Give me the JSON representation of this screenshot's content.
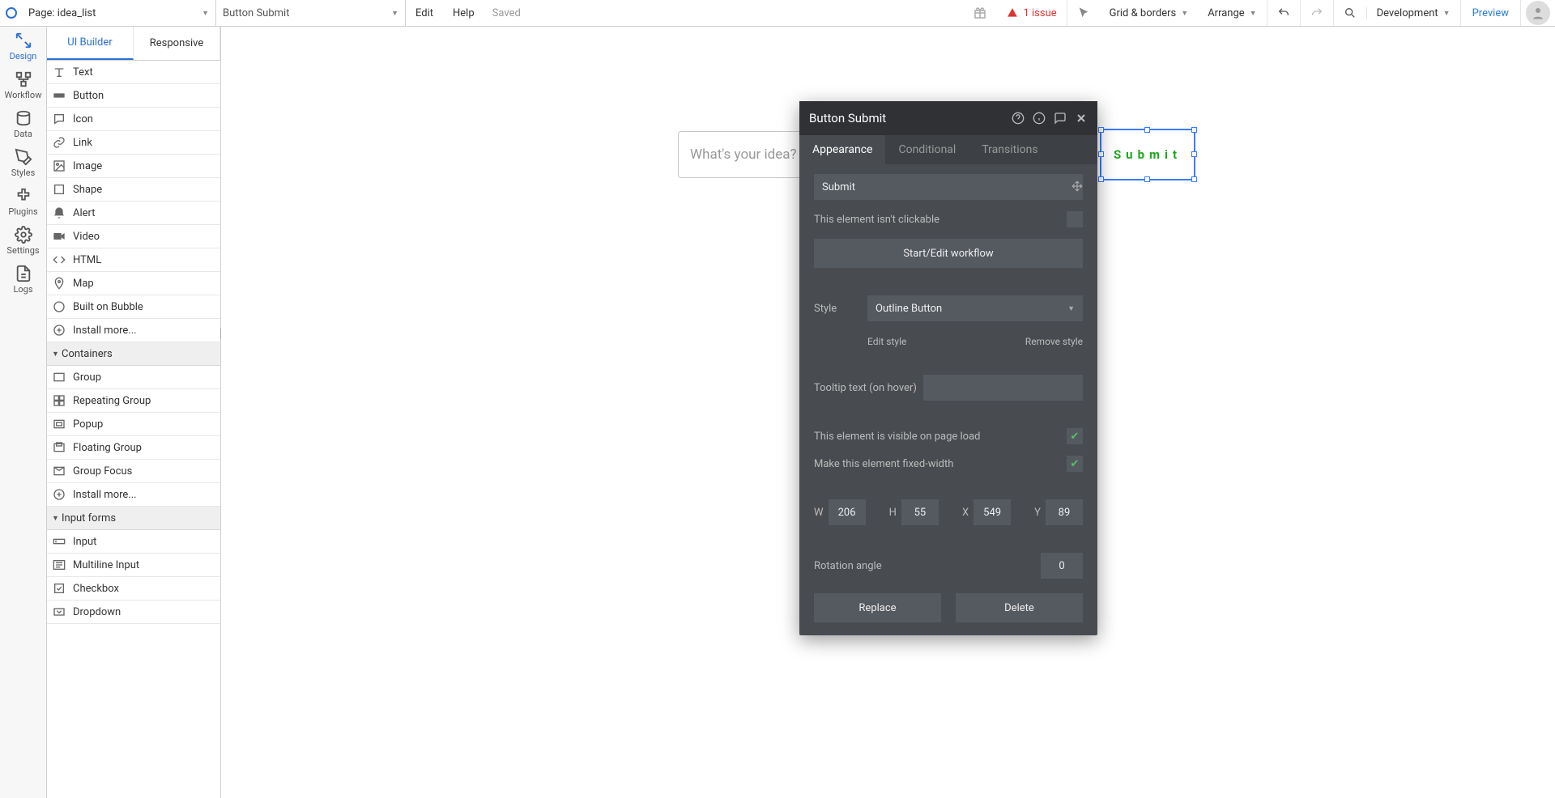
{
  "topbar": {
    "page_prefix": "Page: ",
    "page_name": "idea_list",
    "element_name": "Button Submit",
    "edit": "Edit",
    "help": "Help",
    "saved": "Saved",
    "issue_count": "1 issue",
    "grid_borders": "Grid & borders",
    "arrange": "Arrange",
    "development": "Development",
    "preview": "Preview"
  },
  "leftnav": {
    "design": "Design",
    "workflow": "Workflow",
    "data": "Data",
    "styles": "Styles",
    "plugins": "Plugins",
    "settings": "Settings",
    "logs": "Logs"
  },
  "panel_tabs": {
    "ui_builder": "UI Builder",
    "responsive": "Responsive"
  },
  "palette": {
    "visual": [
      {
        "icon": "text",
        "label": "Text"
      },
      {
        "icon": "button",
        "label": "Button"
      },
      {
        "icon": "icon",
        "label": "Icon"
      },
      {
        "icon": "link",
        "label": "Link"
      },
      {
        "icon": "image",
        "label": "Image"
      },
      {
        "icon": "shape",
        "label": "Shape"
      },
      {
        "icon": "alert",
        "label": "Alert"
      },
      {
        "icon": "video",
        "label": "Video"
      },
      {
        "icon": "html",
        "label": "HTML"
      },
      {
        "icon": "map",
        "label": "Map"
      },
      {
        "icon": "bubble",
        "label": "Built on Bubble"
      },
      {
        "icon": "install",
        "label": "Install more..."
      }
    ],
    "containers_header": "Containers",
    "containers": [
      {
        "icon": "group",
        "label": "Group"
      },
      {
        "icon": "repeating",
        "label": "Repeating Group"
      },
      {
        "icon": "popup",
        "label": "Popup"
      },
      {
        "icon": "floating",
        "label": "Floating Group"
      },
      {
        "icon": "focus",
        "label": "Group Focus"
      },
      {
        "icon": "install",
        "label": "Install more..."
      }
    ],
    "inputs_header": "Input forms",
    "inputs": [
      {
        "icon": "input",
        "label": "Input"
      },
      {
        "icon": "multiline",
        "label": "Multiline Input"
      },
      {
        "icon": "checkbox",
        "label": "Checkbox"
      },
      {
        "icon": "dropdown",
        "label": "Dropdown"
      }
    ]
  },
  "canvas": {
    "idea_placeholder": "What's your idea?",
    "submit_text": "Submit"
  },
  "inspector": {
    "title": "Button Submit",
    "tab_appearance": "Appearance",
    "tab_conditional": "Conditional",
    "tab_transitions": "Transitions",
    "text_value": "Submit",
    "not_clickable": "This element isn't clickable",
    "start_workflow": "Start/Edit workflow",
    "style_label": "Style",
    "style_value": "Outline Button",
    "edit_style": "Edit style",
    "remove_style": "Remove style",
    "tooltip_label": "Tooltip text (on hover)",
    "tooltip_value": "",
    "visible_label": "This element is visible on page load",
    "fixed_width_label": "Make this element fixed-width",
    "W": "W",
    "H": "H",
    "X": "X",
    "Y": "Y",
    "w_val": "206",
    "h_val": "55",
    "x_val": "549",
    "y_val": "89",
    "rotation_label": "Rotation angle",
    "rotation_val": "0",
    "replace": "Replace",
    "delete": "Delete"
  }
}
